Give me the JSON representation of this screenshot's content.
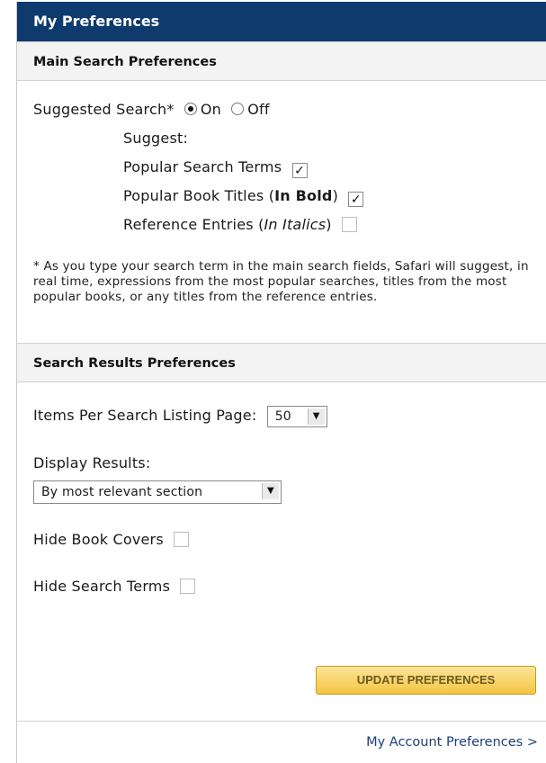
{
  "panel": {
    "title": "My Preferences"
  },
  "main_search": {
    "header": "Main Search Preferences",
    "suggested_label": "Suggested Search*",
    "on_label": "On",
    "off_label": "Off",
    "selected": "On",
    "suggest_label": "Suggest:",
    "options": [
      {
        "label": "Popular Search Terms",
        "extra": "",
        "extra_style": "",
        "checked": true
      },
      {
        "label": "Popular Book Titles (",
        "extra": "In Bold",
        "extra_close": ")",
        "checked": true
      },
      {
        "label": "Reference Entries (",
        "extra": "In Italics",
        "extra_close": ")",
        "checked": false
      }
    ],
    "footnote": "* As you type your search term in the main search fields, Safari will suggest, in real time, expressions from the most popular searches, titles from the most popular books, or any titles from the reference entries."
  },
  "search_results": {
    "header": "Search Results Preferences",
    "items_per_page_label": "Items Per Search Listing Page:",
    "items_per_page_value": "50",
    "display_results_label": "Display Results:",
    "display_results_value": "By most relevant section",
    "hide_covers_label": "Hide Book Covers",
    "hide_covers_checked": false,
    "hide_terms_label": "Hide Search Terms",
    "hide_terms_checked": false
  },
  "update_button": "UPDATE PREFERENCES",
  "account_link": "My Account Preferences >",
  "colors": {
    "title_bar": "#0f3a6e",
    "button": "#f4c542",
    "link": "#1c3f7a"
  }
}
